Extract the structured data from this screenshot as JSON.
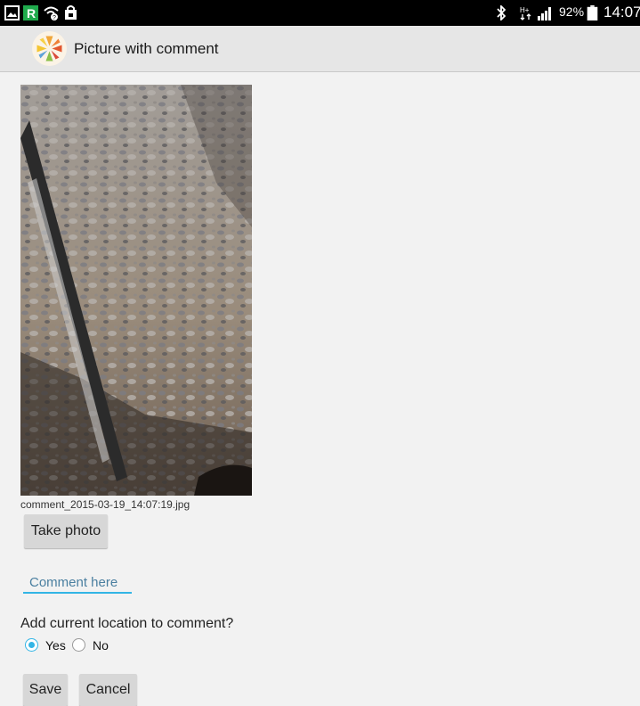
{
  "status_bar": {
    "battery": "92%",
    "time": "14:07",
    "icons": [
      "picture-icon",
      "r-app-icon",
      "wifi-question-icon",
      "shopping-bag-icon",
      "bluetooth-icon",
      "hplus-data-icon",
      "signal-icon",
      "battery-icon"
    ]
  },
  "action_bar": {
    "title": "Picture with comment",
    "logo_icon": "app-logo-icon"
  },
  "photo": {
    "filename": "comment_2015-03-19_14:07:19.jpg"
  },
  "take_photo_label": "Take photo",
  "comment_field": {
    "placeholder": "Comment here",
    "value": ""
  },
  "location": {
    "question": "Add current location to comment?",
    "options": [
      "Yes",
      "No"
    ],
    "selected": "Yes"
  },
  "buttons": {
    "save": "Save",
    "cancel": "Cancel"
  },
  "colors": {
    "accent": "#33b5e5",
    "status_bar": "#000000",
    "action_bar": "#e6e6e6",
    "background": "#f2f2f2"
  }
}
